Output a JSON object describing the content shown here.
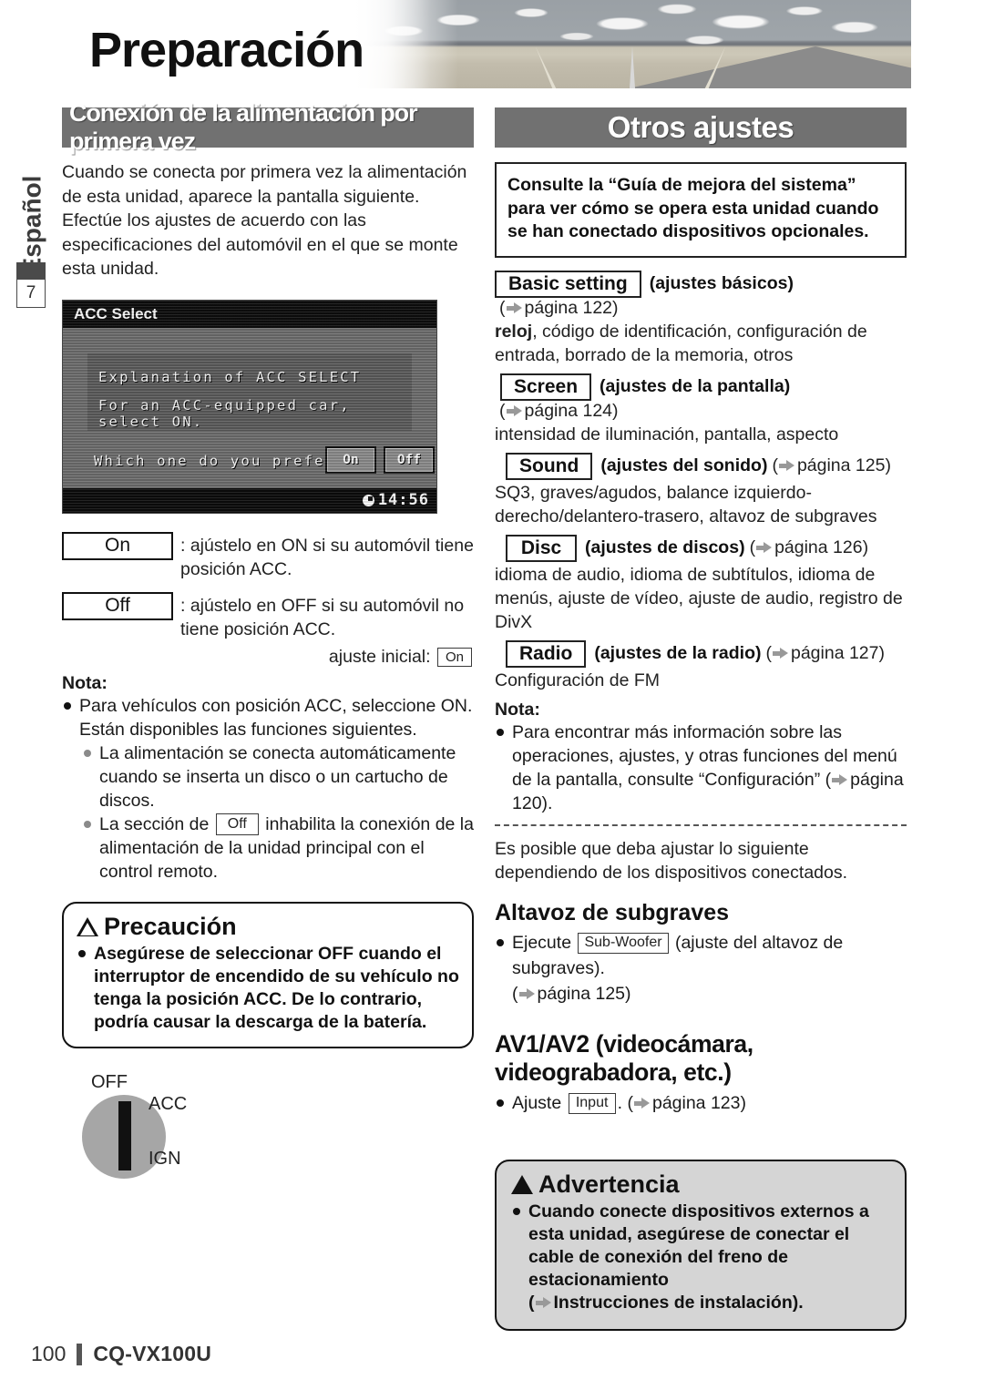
{
  "header": {
    "title": "Preparación",
    "banner_icon": "desert-road-photo"
  },
  "sidebar": {
    "language_tab": "Español",
    "chapter_number": "7"
  },
  "left_column": {
    "section_title": "Conexión de la alimentación por primera vez",
    "intro": "Cuando se conecta por primera vez la alimentación de esta unidad, aparece la pantalla siguiente. Efectúe los ajustes de acuerdo con las especificaciones del automóvil en el que se monte esta unidad.",
    "device_screen": {
      "title": "ACC Select",
      "line1": "Explanation of ACC SELECT",
      "line2": "For an ACC-equipped car, select ON.",
      "question": "Which one do you prefer?",
      "button_on": "On",
      "button_off": "Off",
      "clock": "14:56",
      "clock_icon": "clock-icon"
    },
    "options": [
      {
        "key": "On",
        "desc": ": ajústelo en ON si su automóvil tiene posición ACC."
      },
      {
        "key": "Off",
        "desc": ": ajústelo en OFF si su automóvil no tiene posición ACC."
      }
    ],
    "initial_setting_label": "ajuste inicial:",
    "initial_setting_value": "On",
    "nota_heading": "Nota:",
    "nota_main": "Para vehículos con posición ACC, seleccione ON. Están disponibles las funciones siguientes.",
    "nota_sub_1": "La alimentación se conecta automáticamente cuando se inserta un disco o un cartucho de discos.",
    "nota_sub_2_pre": "La sección de",
    "nota_sub_2_key": "Off",
    "nota_sub_2_post": "inhabilita la conexión de la alimentación de la unidad principal con el control remoto.",
    "caution": {
      "heading": "Precaución",
      "icon": "warning-triangle-icon",
      "body": "Asegúrese de seleccionar OFF cuando el interruptor de encendido de su vehículo no tenga la posición ACC. De lo contrario, podría causar la descarga de la batería."
    },
    "ignition": {
      "icon": "ignition-switch-icon",
      "label_off": "OFF",
      "label_acc": "ACC",
      "label_ign": "IGN"
    }
  },
  "right_column": {
    "section_title": "Otros ajustes",
    "consult_box": "Consulte la “Guía de mejora del sistema” para ver cómo se opera esta unidad cuando se han conectado dispositivos opcionales.",
    "settings": [
      {
        "key": "Basic setting",
        "caption": "(ajustes básicos)",
        "page": "página 122",
        "detail": "reloj, código de identificación, configuración de entrada, borrado de la memoria, otros",
        "detail_bold_lead": "reloj"
      },
      {
        "key": "Screen",
        "caption": "(ajustes de la pantalla)",
        "page": "página 124",
        "detail": "intensidad de iluminación, pantalla, aspecto"
      },
      {
        "key": "Sound",
        "caption": "(ajustes del sonido)",
        "page": "página 125",
        "detail": "SQ3, graves/agudos, balance izquierdo-derecho/delantero-trasero, altavoz de subgraves"
      },
      {
        "key": "Disc",
        "caption": "(ajustes de discos)",
        "page": "página 126",
        "detail": "idioma de audio, idioma de subtítulos, idioma de menús, ajuste de vídeo, ajuste de audio, registro de DivX"
      },
      {
        "key": "Radio",
        "caption": "(ajustes de la radio)",
        "page": "página 127",
        "detail": "Configuración de FM"
      }
    ],
    "nota_heading": "Nota:",
    "nota_body": "Para encontrar más información sobre las operaciones, ajustes, y otras funciones del menú de la pantalla, consulte “Configuración” (",
    "nota_page": "página 120",
    "nota_body_end": ").",
    "after_dashed": "Es posible que deba ajustar lo siguiente dependiendo de los dispositivos conectados.",
    "subwoofer": {
      "heading": "Altavoz de subgraves",
      "bullet_pre": "Ejecute",
      "bullet_key": "Sub-Woofer",
      "bullet_post": "(ajuste del altavoz de subgraves).",
      "page_prefix": "(",
      "page": "página 125",
      "page_suffix": ")"
    },
    "av": {
      "heading": "AV1/AV2 (videocámara, videograbadora, etc.)",
      "bullet_pre": "Ajuste",
      "bullet_key": "Input",
      "bullet_mid": ". (",
      "page": "página 123",
      "bullet_end": ")"
    },
    "warning": {
      "heading": "Advertencia",
      "icon": "warning-triangle-solid-icon",
      "body_1": "Cuando conecte dispositivos externos a esta unidad, asegúrese de conectar el cable de conexión del freno de estacionamiento",
      "body_paren_open": "(",
      "body_ref": "Instrucciones de instalación",
      "body_paren_close": ")."
    }
  },
  "footer": {
    "page_number": "100",
    "model": "CQ-VX100U"
  },
  "colors": {
    "band": "#717171",
    "warning_bg": "#d5d5d5",
    "arrow": "#999999"
  }
}
